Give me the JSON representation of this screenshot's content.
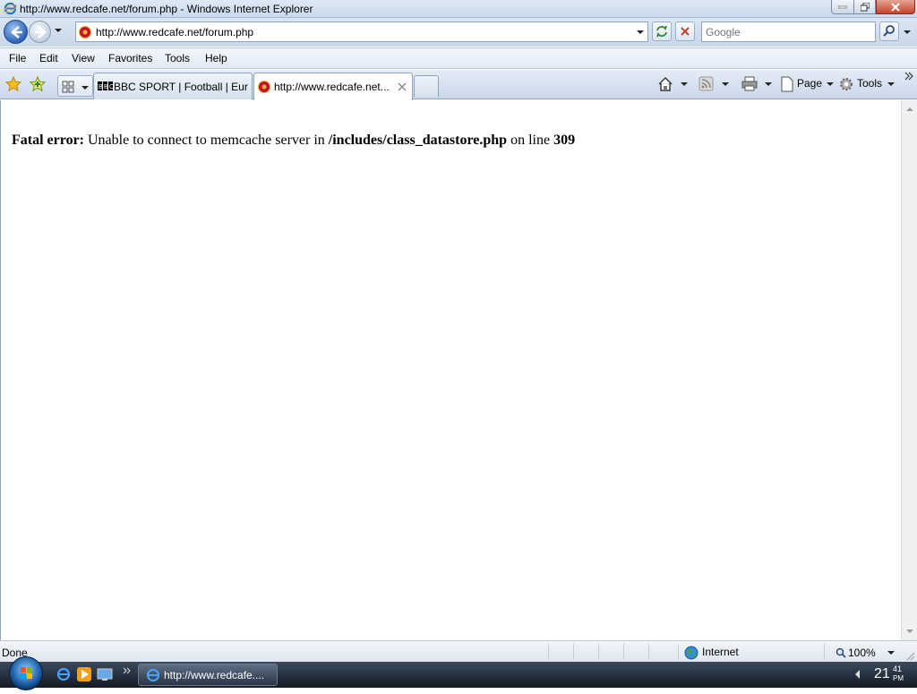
{
  "window": {
    "title": "http://www.redcafe.net/forum.php - Windows Internet Explorer"
  },
  "address_bar": {
    "url": "http://www.redcafe.net/forum.php"
  },
  "search": {
    "placeholder": "Google"
  },
  "menu": {
    "items": [
      "File",
      "Edit",
      "View",
      "Favorites",
      "Tools",
      "Help"
    ]
  },
  "tabs": [
    {
      "label": "BBC SPORT | Football | Eur...",
      "icon": "bbc-icon",
      "active": false
    },
    {
      "label": "http://www.redcafe.net...",
      "icon": "redcafe-icon",
      "active": true
    }
  ],
  "command_bar": {
    "page_label": "Page",
    "tools_label": "Tools"
  },
  "content": {
    "error_label": "Fatal error:",
    "error_text": " Unable to connect to memcache server in ",
    "error_path": "/includes/class_datastore.php",
    "error_line_text": " on line ",
    "error_line": "309"
  },
  "status_bar": {
    "status": "Done",
    "zone": "Internet",
    "zoom": "100%"
  },
  "taskbar": {
    "task_label": "http://www.redcafe....",
    "clock_hour": "21",
    "clock_minute": "41",
    "clock_period": "PM"
  },
  "colors": {
    "accent": "#2a62b8",
    "close_button": "#c5432c"
  }
}
